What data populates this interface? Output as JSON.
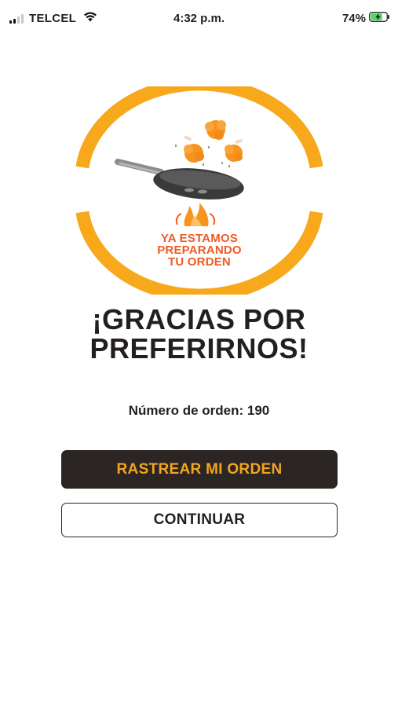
{
  "status_bar": {
    "carrier": "TELCEL",
    "time": "4:32 p.m.",
    "battery_percent": "74%",
    "signal_bars_active": 2,
    "signal_bars_total": 4,
    "battery_level": 0.74,
    "charging": true
  },
  "logo": {
    "line1": "YA ESTAMOS",
    "line2": "PREPARANDO",
    "line3": "TU ORDEN",
    "icons": [
      "frying-pan-icon",
      "chicken-icon",
      "flame-icon"
    ]
  },
  "headline": {
    "line1": "¡GRACIAS POR",
    "line2": "PREFERIRNOS!"
  },
  "order": {
    "label": "Número de orden: 190"
  },
  "buttons": {
    "track_label": "RASTREAR MI ORDEN",
    "continue_label": "CONTINUAR"
  },
  "colors": {
    "brand_orange": "#f7a81b",
    "text_orange": "#f05a24",
    "dark": "#2b2624",
    "button_accent": "#f3a51c"
  }
}
